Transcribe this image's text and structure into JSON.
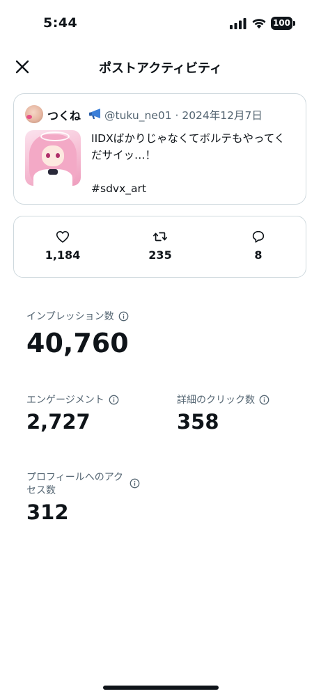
{
  "status_bar": {
    "time": "5:44",
    "battery": "100"
  },
  "header": {
    "title": "ポストアクティビティ",
    "close_icon": "close-icon"
  },
  "post": {
    "author_name": "つくね",
    "handle_date": "@tuku_ne01 · 2024年12月7日",
    "text_line1": "IIDXばかりじゃなくてボルテもやってく",
    "text_line2": "だサイッ…！",
    "hashtag": "#sdvx_art"
  },
  "engagement": {
    "likes": "1,184",
    "reposts": "235",
    "replies": "8"
  },
  "metrics": {
    "impressions_label": "インプレッション数",
    "impressions_value": "40,760",
    "engagements_label": "エンゲージメント",
    "engagements_value": "2,727",
    "detail_clicks_label": "詳細のクリック数",
    "detail_clicks_value": "358",
    "profile_visits_label_line1": "プロフィールへのアク",
    "profile_visits_label_line2": "セス数",
    "profile_visits_value": "312"
  },
  "colors": {
    "text_primary": "#0f1419",
    "text_secondary": "#536471",
    "border": "#cfd9de",
    "background": "#ffffff"
  }
}
